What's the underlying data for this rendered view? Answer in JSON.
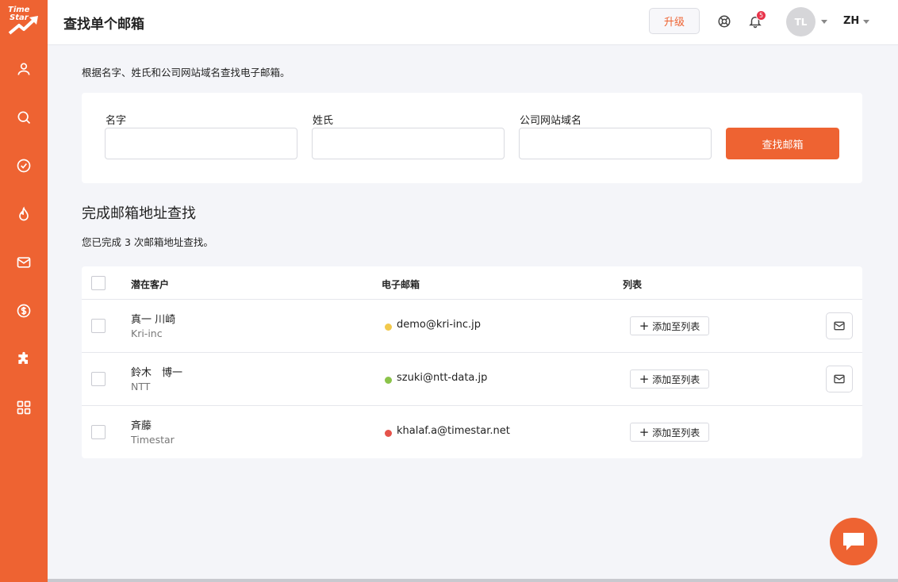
{
  "app": {
    "logo_text_1": "Time",
    "logo_text_2": "Star",
    "brand_color": "#ee6332"
  },
  "sidebar": {
    "items": [
      {
        "icon": "user-icon"
      },
      {
        "icon": "search-icon"
      },
      {
        "icon": "check-circle-icon"
      },
      {
        "icon": "flame-icon"
      },
      {
        "icon": "mail-icon"
      },
      {
        "icon": "dollar-icon"
      },
      {
        "icon": "puzzle-icon"
      },
      {
        "icon": "grid-icon"
      }
    ]
  },
  "header": {
    "title": "查找单个邮箱",
    "upgrade_label": "升级",
    "notification_count": "5",
    "avatar_initials": "TL",
    "language": "ZH"
  },
  "intro": "根据名字、姓氏和公司网站域名查找电子邮箱。",
  "form": {
    "first_name_label": "名字",
    "last_name_label": "姓氏",
    "domain_label": "公司网站域名",
    "first_name_value": "",
    "last_name_value": "",
    "domain_value": "",
    "submit_label": "查找邮箱"
  },
  "results": {
    "title": "完成邮箱地址查找",
    "subtitle": "您已完成 3 次邮箱地址查找。",
    "columns": [
      "潜在客户",
      "电子邮箱",
      "列表"
    ],
    "add_label": "添加至列表",
    "rows": [
      {
        "name": "真一 川崎",
        "company": "Kri-inc",
        "email": "demo@kri-inc.jp",
        "status_color": "#f2c94c",
        "has_mail": true
      },
      {
        "name": "鈴木　博一",
        "company": "NTT",
        "email": "szuki@ntt-data.jp",
        "status_color": "#8bc34a",
        "has_mail": true
      },
      {
        "name": "斉藤",
        "company": "Timestar",
        "email": "khalaf.a@timestar.net",
        "status_color": "#e5534b",
        "has_mail": false
      }
    ]
  }
}
